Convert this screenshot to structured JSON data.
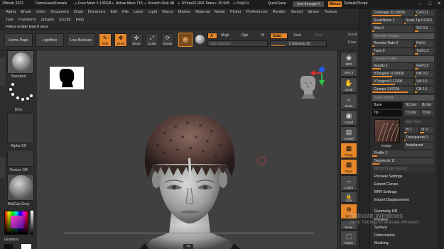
{
  "titlebar": {
    "app": "ZBrush 2021",
    "document": "DemoHeadFemale",
    "free_mem": "Free Mem 5.135GB",
    "active_mem": "Active Mem 715",
    "scratch_disk": "Scratch Disk 48",
    "rtime": "RTime",
    "timer": "21.064 Timer",
    "timer2": "20.945",
    "polycount": "PolyCo",
    "quicksave": "QuickSave",
    "see_through": "See-through 0",
    "menus": "Menus",
    "script": "DefaultZScript",
    "minimize": "–",
    "maximize": "□",
    "close": "✕"
  },
  "menubar": {
    "row1": [
      "Alpha",
      "Brush",
      "Color",
      "Document",
      "Draw",
      "Dynamics",
      "Edit",
      "File",
      "Layer",
      "Light",
      "Macro",
      "Marker",
      "Material",
      "Movie",
      "Picker",
      "Preferences",
      "Render",
      "Stencil",
      "Stroke",
      "Texture"
    ],
    "row2": [
      "Tool",
      "Transform",
      "Zplugin",
      "Zscript",
      "Help"
    ]
  },
  "note": "Filters render time 0 secs",
  "toolbar": {
    "home_page": "Home Page",
    "lightbox": "LightBox",
    "live_boolean": "Live Boolean",
    "edit": "Edit",
    "draw": "Draw",
    "move": "Move",
    "scale": "Scale",
    "rotate": "Rotate",
    "a_label": "A",
    "mrgb": "Mrgb",
    "rgb": "Rgb",
    "m": "M",
    "zadd": "Zadd",
    "zsub": "Zsub",
    "zcut": "Zcut",
    "rgb_intensity": "Rgb Intensity",
    "z_intensity": "Z Intensity 25",
    "focal": "Focal",
    "draw_size": "Draw"
  },
  "left_tray": {
    "standard": "Standard",
    "dots": "Dots",
    "alpha_off": "Alpha Off",
    "texture_off": "Texture Off",
    "matcap": "MatCap Gray",
    "gradient": "Gradient"
  },
  "shelf": {
    "bpr": "BPR",
    "spix": "SPix 3",
    "scroll": "Scroll",
    "zoom": "Zoom",
    "actual": "Actual",
    "aahalf": "AAHalf",
    "persp": "Persp",
    "floor": "Floor",
    "lsym": "L.Sym",
    "lock": "Lock",
    "qxyz": "Qxyz",
    "move": "Move",
    "frame": "Frame",
    "move2": "Move"
  },
  "palette": {
    "coverage": "Coverage 33.32635",
    "cvil": "CvIl 0.1",
    "scale_noise": "ScaleNoise 1",
    "scale_tip": "Scale Tip 0.0116",
    "slim": "Slim 0",
    "slim_r": "SlV 0.2",
    "revolve_radius": "Revolve Radius",
    "revolve_rate": "Revolve Rate 0",
    "rvil": "RvIl 0",
    "twist": "Twist 0",
    "twil": "TwIl 0.2",
    "gravity_profile": "Gravity Profile",
    "gravity": "Gravity 1",
    "gvil": "GvIl 0.2",
    "htangent": "HTangent -0.00826",
    "htil": "HtIl 0.0",
    "vtangent": "VTangent 0.12396",
    "vtil": "VtIl 0.0",
    "clumps": "Clumps 0.87604",
    "clil": "ClIl 0.1",
    "color_profile": "Color Profile",
    "base": "Base",
    "bcolor": "BColor",
    "bcvar": "BcVar",
    "tip": "Tip",
    "tcolor": "TColor",
    "tcvar": "TcVar",
    "max_topo": "Max Topo",
    "hi": "Hi 1",
    "vr": "Vr 2",
    "transparent": "Transparent 0",
    "image": "Image",
    "antialiased": "Antialiased",
    "profile": "Profile 1",
    "segments": "Segments 11",
    "morph_target": "MorphTarget Guided",
    "preview_settings": "Preview Settings",
    "export_curves": "Export Curves",
    "bpr_settings": "BPR Settings",
    "export_displacement": "Export Displacement",
    "geometry_hd": "Geometry HD",
    "preview": "Preview",
    "surface": "Surface",
    "deformation": "Deformation",
    "masking": "Masking"
  },
  "watermark": {
    "line1": "Activate Windows",
    "line2": "Go to Settings to activate Windows."
  },
  "colors": {
    "accent": "#e6882a",
    "panel": "#2b2b2b",
    "viewport": "#404040"
  }
}
